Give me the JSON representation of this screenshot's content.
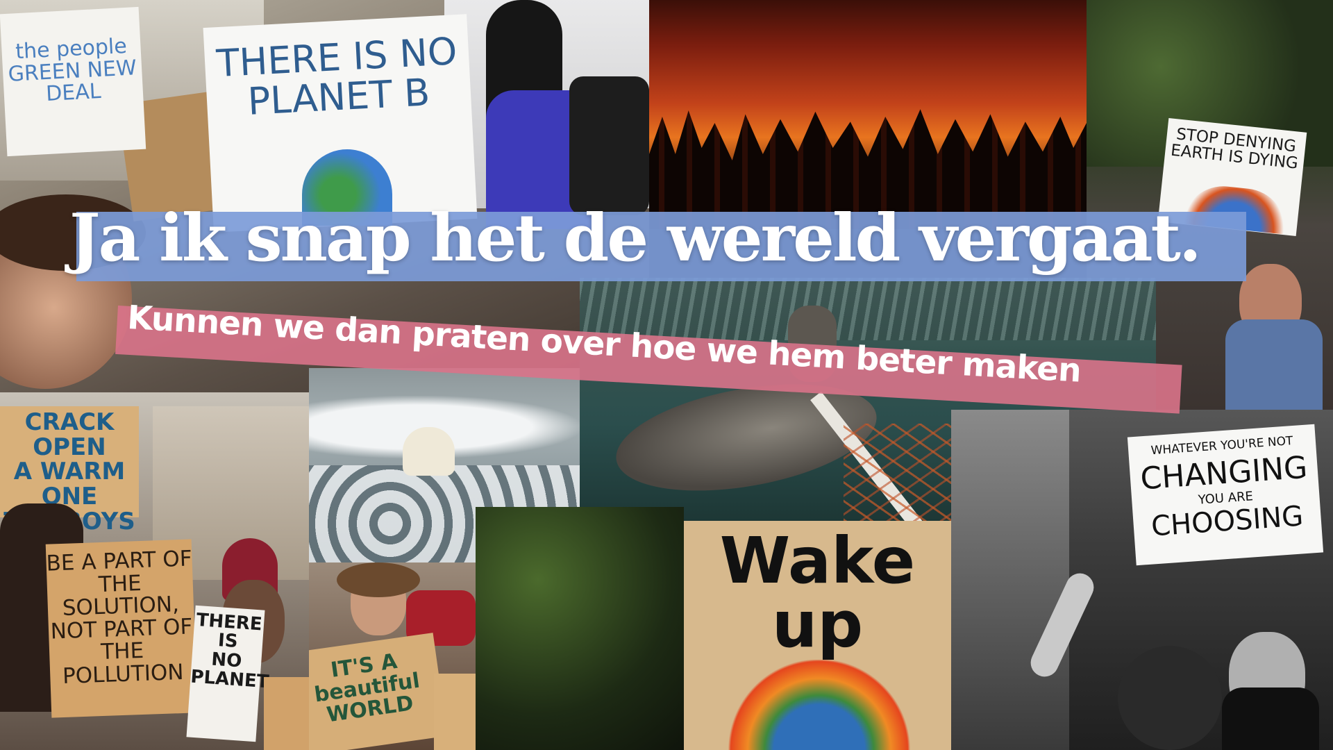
{
  "headline": "Ja ik snap het de wereld vergaat.",
  "subline": "Kunnen we dan praten over hoe we hem beter maken",
  "signs": {
    "top_left": "the people\nGREEN NEW DEAL",
    "planet_b": "THERE IS NO\nPLANET B",
    "stop_denying": "STOP DENYING\nEARTH IS DYING",
    "crack_open": "CRACK OPEN\nA WARM ONE\nTHE BOYS",
    "be_a_part": "BE A PART OF\nTHE SOLUTION,\nNOT PART OF\nTHE POLLUTION",
    "there_is_no": "THERE IS\nNO\nPLANET",
    "beautiful_world": "IT'S A beautiful\nWORLD",
    "wake_up": "Wake\nup",
    "whatever_line1": "WHATEVER YOU'RE NOT",
    "whatever_line2": "CHANGING",
    "whatever_line3": "YOU ARE",
    "whatever_line4": "CHOOSING"
  },
  "colors": {
    "headline_bar": "#7c9bd8",
    "subline_bar": "#d9738a"
  }
}
